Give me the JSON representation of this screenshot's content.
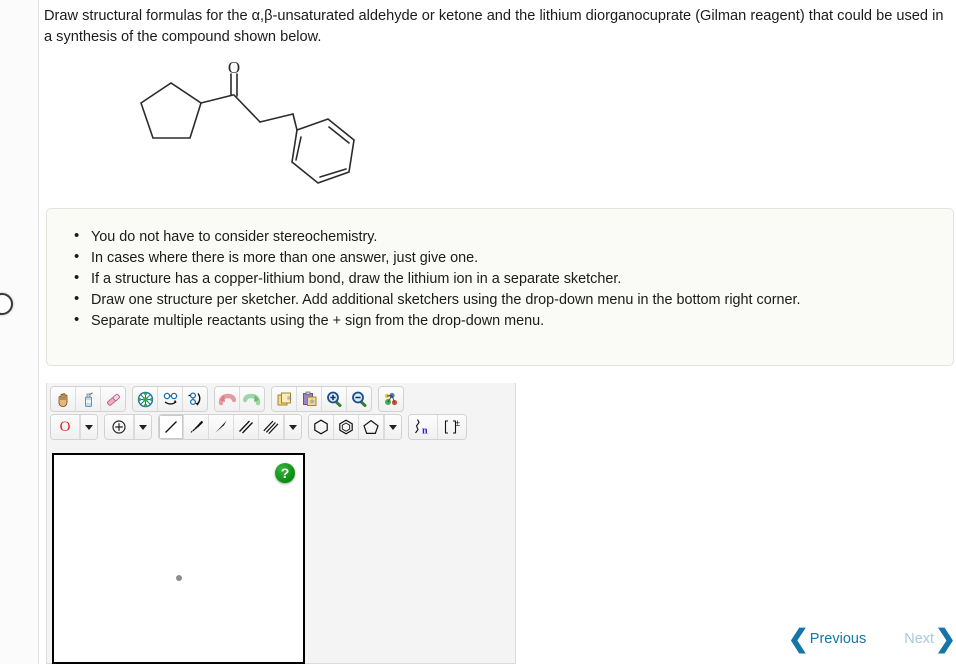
{
  "question": {
    "line1": "Draw structural formulas for the α,β-unsaturated aldehyde or ketone and the lithium diorganocuprate (Gilman reagent)",
    "line2": "that could be used in a synthesis of the compound shown below."
  },
  "structure": {
    "label_oxygen": "O",
    "description": "1-cyclopentyl-3-phenylpropan-1-one skeletal structure"
  },
  "instructions": {
    "items": [
      "You do not have to consider stereochemistry.",
      "In cases where there is more than one answer, just give one.",
      "If a structure has a copper-lithium bond, draw the lithium ion in a separate sketcher.",
      "Draw one structure per sketcher. Add additional sketchers using the drop-down menu in the bottom right corner.",
      "Separate multiple reactants using the + sign from the drop-down menu."
    ]
  },
  "sketcher": {
    "toolbar_row1": [
      {
        "name": "pan-hand-icon",
        "title": "Pan"
      },
      {
        "name": "cleanup-spray-icon",
        "title": "Clean up structure"
      },
      {
        "name": "eraser-icon",
        "title": "Eraser"
      },
      {
        "name": "select-all-icon",
        "title": "Select"
      },
      {
        "name": "flip-horizontal-icon",
        "title": "Flip horizontal"
      },
      {
        "name": "rotate-icon",
        "title": "Rotate"
      },
      {
        "name": "undo-icon",
        "title": "Undo"
      },
      {
        "name": "redo-icon",
        "title": "Redo"
      },
      {
        "name": "copy-icon",
        "title": "Copy"
      },
      {
        "name": "paste-icon",
        "title": "Paste"
      },
      {
        "name": "zoom-in-icon",
        "title": "Zoom in"
      },
      {
        "name": "zoom-out-icon",
        "title": "Zoom out"
      },
      {
        "name": "templates-icon",
        "title": "Templates"
      }
    ],
    "atom_tool": {
      "label": "O",
      "color": "#e02020"
    },
    "charge_tool": {
      "glyph": "⊕"
    },
    "bond_tools": [
      {
        "name": "single-bond-icon",
        "selected": true
      },
      {
        "name": "hash-wedge-bond-icon",
        "selected": false
      },
      {
        "name": "wedge-bond-icon",
        "selected": false
      },
      {
        "name": "double-bond-icon",
        "selected": false
      },
      {
        "name": "triple-bond-icon",
        "selected": false
      }
    ],
    "ring_tools": [
      {
        "name": "benzene-ring-icon"
      },
      {
        "name": "aromatic-ring-icon"
      },
      {
        "name": "cyclopentane-ring-icon"
      }
    ],
    "chain_tool": {
      "name": "polymer-chain-icon",
      "label": "n",
      "label_color": "#3a17d8"
    },
    "bracket_tool": {
      "name": "bracket-charge-icon",
      "label": "[ ]±"
    },
    "help_badge": "?"
  },
  "nav": {
    "previous_label": "Previous",
    "next_label": "Next",
    "prev_chevron": "‹",
    "next_chevron": "›"
  }
}
